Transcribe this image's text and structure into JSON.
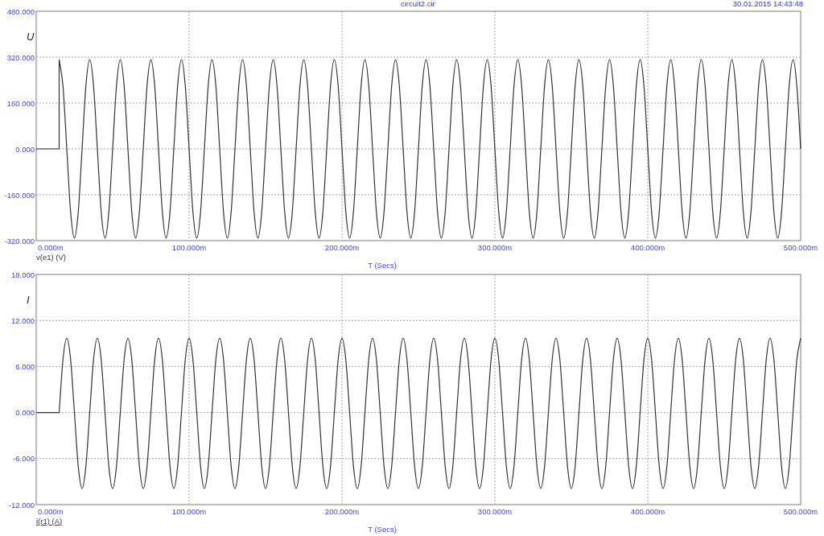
{
  "header": {
    "file_name": "circuit2.cir",
    "timestamp": "30.01.2015 14:43:48"
  },
  "panels": [
    {
      "trace_label": {
        "text": "v(e1) (V)",
        "selected": false
      },
      "chart_data": {
        "type": "line",
        "grid": true,
        "xlabel": "T (Secs)",
        "ylabel": "U",
        "xlim": [
          0,
          500
        ],
        "ylim": [
          -320,
          480
        ],
        "xticks": [
          {
            "value": 0,
            "label": "0.000m"
          },
          {
            "value": 100,
            "label": "100.000m"
          },
          {
            "value": 200,
            "label": "200.000m"
          },
          {
            "value": 300,
            "label": "300.000m"
          },
          {
            "value": 400,
            "label": "400.000m"
          },
          {
            "value": 500,
            "label": "500.000m"
          }
        ],
        "yticks": [
          {
            "value": 480,
            "label": "480.000"
          },
          {
            "value": 320,
            "label": "320.000"
          },
          {
            "value": 160,
            "label": "160.000"
          },
          {
            "value": 0,
            "label": "0.000"
          },
          {
            "value": -160,
            "label": "-160.000"
          },
          {
            "value": -320,
            "label": "-320.000"
          }
        ],
        "x": [
          0,
          2.5,
          5,
          7.5,
          10,
          12.5,
          15,
          15,
          17.5,
          20,
          22.5,
          25,
          27.5,
          30,
          32.5,
          35,
          37.5,
          40,
          42.5,
          45,
          47.5,
          50,
          52.5,
          55,
          57.5,
          60,
          62.5,
          65,
          67.5,
          70,
          72.5,
          75,
          77.5,
          80,
          82.5,
          85,
          87.5,
          90,
          92.5,
          95,
          97.5,
          100,
          102.5,
          105,
          107.5,
          110,
          112.5,
          115,
          117.5,
          120,
          122.5,
          125,
          127.5,
          130,
          132.5,
          135,
          137.5,
          140,
          142.5,
          145,
          147.5,
          150,
          152.5,
          155,
          157.5,
          160,
          162.5,
          165,
          167.5,
          170,
          172.5,
          175,
          177.5,
          180,
          182.5,
          185,
          187.5,
          190,
          192.5,
          195,
          197.5,
          200,
          202.5,
          205,
          207.5,
          210,
          212.5,
          215,
          217.5,
          220,
          222.5,
          225,
          227.5,
          230,
          232.5,
          235,
          237.5,
          240,
          242.5,
          245,
          247.5,
          250,
          252.5,
          255,
          257.5,
          260,
          262.5,
          265,
          267.5,
          270,
          272.5,
          275,
          277.5,
          280,
          282.5,
          285,
          287.5,
          290,
          292.5,
          295,
          297.5,
          300,
          302.5,
          305,
          307.5,
          310,
          312.5,
          315,
          317.5,
          320,
          322.5,
          325,
          327.5,
          330,
          332.5,
          335,
          337.5,
          340,
          342.5,
          345,
          347.5,
          350,
          352.5,
          355,
          357.5,
          360,
          362.5,
          365,
          367.5,
          370,
          372.5,
          375,
          377.5,
          380,
          382.5,
          385,
          387.5,
          390,
          392.5,
          395,
          397.5,
          400,
          402.5,
          405,
          407.5,
          410,
          412.5,
          415,
          417.5,
          420,
          422.5,
          425,
          427.5,
          430,
          432.5,
          435,
          437.5,
          440,
          442.5,
          445,
          447.5,
          450,
          452.5,
          455,
          457.5,
          460,
          462.5,
          465,
          467.5,
          470,
          472.5,
          475,
          477.5,
          480,
          482.5,
          485,
          487.5,
          490,
          492.5,
          495,
          497.5,
          500
        ],
        "series": [
          {
            "color": "#333333",
            "values": [
              0,
              0,
              0,
              0,
              0,
              0,
              0,
              311,
              220,
              0,
              -220,
              -311,
              -220,
              0,
              220,
              311,
              220,
              0,
              -220,
              -311,
              -220,
              0,
              220,
              311,
              220,
              0,
              -220,
              -311,
              -220,
              0,
              220,
              311,
              220,
              0,
              -220,
              -311,
              -220,
              0,
              220,
              311,
              220,
              0,
              -220,
              -311,
              -220,
              0,
              220,
              311,
              220,
              0,
              -220,
              -311,
              -220,
              0,
              220,
              311,
              220,
              0,
              -220,
              -311,
              -220,
              0,
              220,
              311,
              220,
              0,
              -220,
              -311,
              -220,
              0,
              220,
              311,
              220,
              0,
              -220,
              -311,
              -220,
              0,
              220,
              311,
              220,
              0,
              -220,
              -311,
              -220,
              0,
              220,
              311,
              220,
              0,
              -220,
              -311,
              -220,
              0,
              220,
              311,
              220,
              0,
              -220,
              -311,
              -220,
              0,
              220,
              311,
              220,
              0,
              -220,
              -311,
              -220,
              0,
              220,
              311,
              220,
              0,
              -220,
              -311,
              -220,
              0,
              220,
              311,
              220,
              0,
              -220,
              -311,
              -220,
              0,
              220,
              311,
              220,
              0,
              -220,
              -311,
              -220,
              0,
              220,
              311,
              220,
              0,
              -220,
              -311,
              -220,
              0,
              220,
              311,
              220,
              0,
              -220,
              -311,
              -220,
              0,
              220,
              311,
              220,
              0,
              -220,
              -311,
              -220,
              0,
              220,
              311,
              220,
              0,
              -220,
              -311,
              -220,
              0,
              220,
              311,
              220,
              0,
              -220,
              -311,
              -220,
              0,
              220,
              311,
              220,
              0,
              -220,
              -311,
              -220,
              0,
              220,
              311,
              220,
              0,
              -220,
              -311,
              -220,
              0,
              220,
              311,
              220,
              0,
              -220,
              -311,
              -220,
              0,
              220,
              311,
              220,
              0
            ]
          }
        ]
      }
    },
    {
      "trace_label": {
        "text": "i(r1) (A)",
        "selected": true
      },
      "chart_data": {
        "type": "line",
        "grid": true,
        "xlabel": "T (Secs)",
        "ylabel": "I",
        "xlim": [
          0,
          500
        ],
        "ylim": [
          -12,
          18
        ],
        "xticks": [
          {
            "value": 0,
            "label": "0.000m"
          },
          {
            "value": 100,
            "label": "100.000m"
          },
          {
            "value": 200,
            "label": "200.000m"
          },
          {
            "value": 300,
            "label": "300.000m"
          },
          {
            "value": 400,
            "label": "400.000m"
          },
          {
            "value": 500,
            "label": "500.000m"
          }
        ],
        "yticks": [
          {
            "value": 18,
            "label": "18.000"
          },
          {
            "value": 12,
            "label": "12.000"
          },
          {
            "value": 6,
            "label": "6.000"
          },
          {
            "value": 0,
            "label": "0.000"
          },
          {
            "value": -6,
            "label": "-6.000"
          },
          {
            "value": -12,
            "label": "-12.000"
          }
        ],
        "x": [
          0,
          2.5,
          5,
          7.5,
          10,
          12.5,
          15,
          15,
          17.5,
          20,
          22.5,
          25,
          27.5,
          30,
          32.5,
          35,
          37.5,
          40,
          42.5,
          45,
          47.5,
          50,
          52.5,
          55,
          57.5,
          60,
          62.5,
          65,
          67.5,
          70,
          72.5,
          75,
          77.5,
          80,
          82.5,
          85,
          87.5,
          90,
          92.5,
          95,
          97.5,
          100,
          102.5,
          105,
          107.5,
          110,
          112.5,
          115,
          117.5,
          120,
          122.5,
          125,
          127.5,
          130,
          132.5,
          135,
          137.5,
          140,
          142.5,
          145,
          147.5,
          150,
          152.5,
          155,
          157.5,
          160,
          162.5,
          165,
          167.5,
          170,
          172.5,
          175,
          177.5,
          180,
          182.5,
          185,
          187.5,
          190,
          192.5,
          195,
          197.5,
          200,
          202.5,
          205,
          207.5,
          210,
          212.5,
          215,
          217.5,
          220,
          222.5,
          225,
          227.5,
          230,
          232.5,
          235,
          237.5,
          240,
          242.5,
          245,
          247.5,
          250,
          252.5,
          255,
          257.5,
          260,
          262.5,
          265,
          267.5,
          270,
          272.5,
          275,
          277.5,
          280,
          282.5,
          285,
          287.5,
          290,
          292.5,
          295,
          297.5,
          300,
          302.5,
          305,
          307.5,
          310,
          312.5,
          315,
          317.5,
          320,
          322.5,
          325,
          327.5,
          330,
          332.5,
          335,
          337.5,
          340,
          342.5,
          345,
          347.5,
          350,
          352.5,
          355,
          357.5,
          360,
          362.5,
          365,
          367.5,
          370,
          372.5,
          375,
          377.5,
          380,
          382.5,
          385,
          387.5,
          390,
          392.5,
          395,
          397.5,
          400,
          402.5,
          405,
          407.5,
          410,
          412.5,
          415,
          417.5,
          420,
          422.5,
          425,
          427.5,
          430,
          432.5,
          435,
          437.5,
          440,
          442.5,
          445,
          447.5,
          450,
          452.5,
          455,
          457.5,
          460,
          462.5,
          465,
          467.5,
          470,
          472.5,
          475,
          477.5,
          480,
          482.5,
          485,
          487.5,
          490,
          492.5,
          495,
          497.5,
          500
        ],
        "series": [
          {
            "color": "#333333",
            "values": [
              0,
              0,
              0,
              0,
              0,
              0,
              0,
              0,
              6.9,
              9.7,
              6.9,
              0,
              -7,
              -9.9,
              -7,
              0,
              6.9,
              9.7,
              6.9,
              0,
              -7,
              -9.9,
              -7,
              0,
              6.9,
              9.7,
              6.9,
              0,
              -7,
              -9.9,
              -7,
              0,
              6.9,
              9.7,
              6.9,
              0,
              -7,
              -9.9,
              -7,
              0,
              6.9,
              9.7,
              6.9,
              0,
              -7,
              -9.9,
              -7,
              0,
              6.9,
              9.7,
              6.9,
              0,
              -7,
              -9.9,
              -7,
              0,
              6.9,
              9.7,
              6.9,
              0,
              -7,
              -9.9,
              -7,
              0,
              6.9,
              9.7,
              6.9,
              0,
              -7,
              -9.9,
              -7,
              0,
              6.9,
              9.7,
              6.9,
              0,
              -7,
              -9.9,
              -7,
              0,
              6.9,
              9.7,
              6.9,
              0,
              -7,
              -9.9,
              -7,
              0,
              6.9,
              9.7,
              6.9,
              0,
              -7,
              -9.9,
              -7,
              0,
              6.9,
              9.7,
              6.9,
              0,
              -7,
              -9.9,
              -7,
              0,
              6.9,
              9.7,
              6.9,
              0,
              -7,
              -9.9,
              -7,
              0,
              6.9,
              9.7,
              6.9,
              0,
              -7,
              -9.9,
              -7,
              0,
              6.9,
              9.7,
              6.9,
              0,
              -7,
              -9.9,
              -7,
              0,
              6.9,
              9.7,
              6.9,
              0,
              -7,
              -9.9,
              -7,
              0,
              6.9,
              9.7,
              6.9,
              0,
              -7,
              -9.9,
              -7,
              0,
              6.9,
              9.7,
              6.9,
              0,
              -7,
              -9.9,
              -7,
              0,
              6.9,
              9.7,
              6.9,
              0,
              -7,
              -9.9,
              -7,
              0,
              6.9,
              9.7,
              6.9,
              0,
              -7,
              -9.9,
              -7,
              0,
              6.9,
              9.7,
              6.9,
              0,
              -7,
              -9.9,
              -7,
              0,
              6.9,
              9.7,
              6.9,
              0,
              -7,
              -9.9,
              -7,
              0,
              6.9,
              9.7,
              6.9,
              0,
              -7,
              -9.9,
              -7,
              0,
              6.9,
              9.7,
              6.9,
              0,
              -7,
              -9.9,
              -7,
              0,
              6.9,
              9.7
            ]
          }
        ]
      }
    }
  ]
}
